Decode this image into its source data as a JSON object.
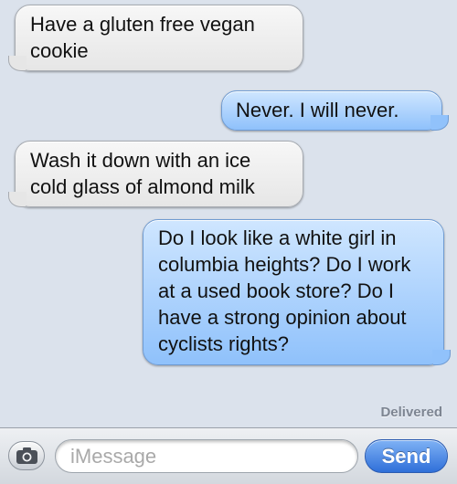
{
  "thread": {
    "messages": [
      {
        "direction": "incoming",
        "text": "Have a gluten free vegan cookie"
      },
      {
        "direction": "outgoing",
        "text": "Never. I will never."
      },
      {
        "direction": "incoming",
        "text": "Wash it down with an ice cold glass of almond milk"
      },
      {
        "direction": "outgoing",
        "text": "Do I look like a white girl in columbia heights? Do I work at a used book store? Do I have a strong opinion about cyclists rights?"
      }
    ],
    "status": "Delivered"
  },
  "composer": {
    "camera_icon": "camera-icon",
    "placeholder": "iMessage",
    "send_label": "Send"
  },
  "colors": {
    "background": "#dbe2ec",
    "incoming_bubble": "#e6e6e6",
    "outgoing_bubble": "#8fc1fb",
    "send_button": "#2f6fd9"
  }
}
